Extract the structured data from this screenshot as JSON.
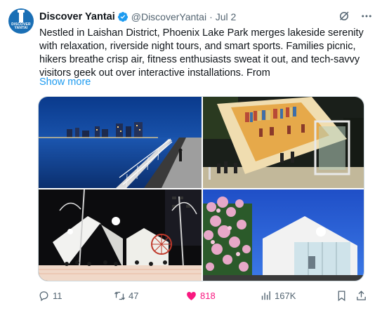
{
  "tweet": {
    "author_name": "Discover Yantai",
    "avatar_text": "DISCOVER YANTAI",
    "handle": "@DiscoverYantai",
    "separator": "·",
    "date": "Jul 2",
    "text": "Nestled in Laishan District, Phoenix Lake Park merges lakeside serenity with relaxation, riverside night tours, and smart sports. Families picnic, hikers breathe crisp air, fitness enthusiasts sweat it out, and tech-savvy visitors geek out over interactive installations. From",
    "show_more": "Show more"
  },
  "actions": {
    "replies": "11",
    "retweets": "47",
    "likes": "818",
    "views": "167K"
  },
  "colors": {
    "accent": "#1d9bf0",
    "like": "#f91880",
    "muted": "#536471",
    "verified": "#1d9bf0"
  }
}
